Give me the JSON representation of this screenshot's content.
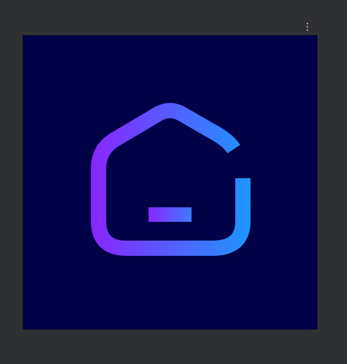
{
  "viewer": {
    "menu_icon": "more-vert-icon",
    "menu_glyph": "⋮"
  },
  "image": {
    "subject": "home-logo-icon",
    "colors": {
      "viewer_background": "#2f3033",
      "image_background": "#000046",
      "gradient_start": "#8a24ff",
      "gradient_end": "#1e96ff"
    }
  }
}
